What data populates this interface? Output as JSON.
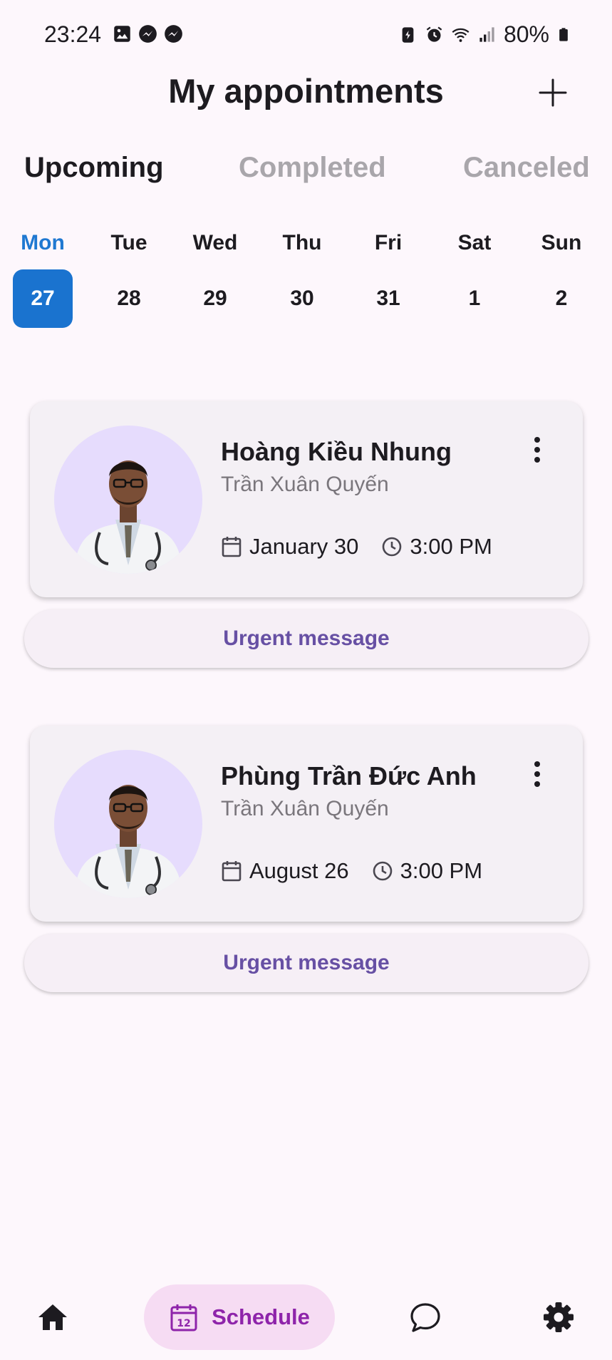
{
  "status_bar": {
    "time": "23:24",
    "battery": "80%",
    "left_icons": [
      "gallery-icon",
      "messenger-icon",
      "messenger-icon"
    ],
    "right_icons": [
      "battery-saver-icon",
      "alarm-icon",
      "wifi-icon",
      "signal-icon",
      "battery-icon"
    ]
  },
  "header": {
    "title": "My appointments",
    "add_icon": "plus-icon"
  },
  "tabs": [
    {
      "label": "Upcoming",
      "active": true
    },
    {
      "label": "Completed",
      "active": false
    },
    {
      "label": "Canceled",
      "active": false
    }
  ],
  "week": {
    "days": [
      {
        "name": "Mon",
        "num": "27",
        "selected": true
      },
      {
        "name": "Tue",
        "num": "28",
        "selected": false
      },
      {
        "name": "Wed",
        "num": "29",
        "selected": false
      },
      {
        "name": "Thu",
        "num": "30",
        "selected": false
      },
      {
        "name": "Fri",
        "num": "31",
        "selected": false
      },
      {
        "name": "Sat",
        "num": "1",
        "selected": false
      },
      {
        "name": "Sun",
        "num": "2",
        "selected": false
      }
    ]
  },
  "appointments": [
    {
      "patient": "Hoàng Kiều Nhung",
      "doctor": "Trần Xuân Quyến",
      "date": "January 30",
      "time": "3:00 PM",
      "urgent_label": "Urgent message"
    },
    {
      "patient": "Phùng Trần Đức Anh",
      "doctor": "Trần Xuân Quyến",
      "date": "August 26",
      "time": "3:00 PM",
      "urgent_label": "Urgent message"
    }
  ],
  "bottom_nav": {
    "items": [
      {
        "icon": "home-icon",
        "label": "",
        "active": false
      },
      {
        "icon": "calendar-icon",
        "label": "Schedule",
        "active": true
      },
      {
        "icon": "chat-icon",
        "label": "",
        "active": false
      },
      {
        "icon": "settings-icon",
        "label": "",
        "active": false
      }
    ]
  },
  "colors": {
    "background": "#fdf7fc",
    "accent_blue": "#1a73cf",
    "urgent_text": "#6750a4",
    "schedule_active_bg": "#f6dcf3",
    "schedule_active_text": "#8e24aa",
    "avatar_bg": "#e6dcfd"
  }
}
